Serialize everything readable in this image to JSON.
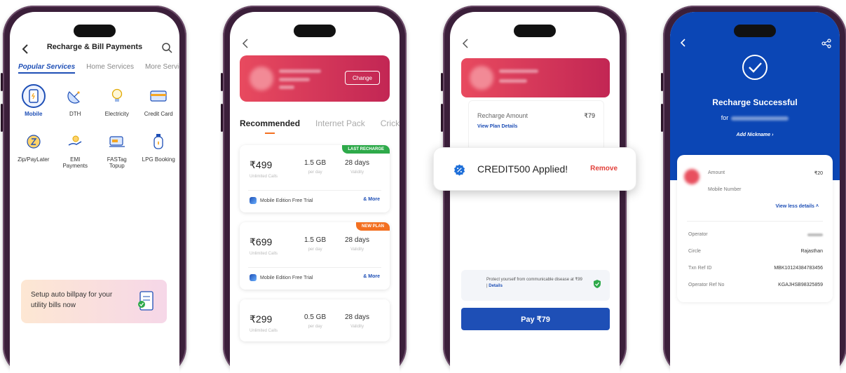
{
  "screen1": {
    "title": "Recharge & Bill Payments",
    "tabs": [
      "Popular Services",
      "Home Services",
      "More Services"
    ],
    "services": [
      {
        "label": "Mobile",
        "icon": "mobile-icon",
        "selected": true
      },
      {
        "label": "DTH",
        "icon": "satellite-dish-icon"
      },
      {
        "label": "Electricity",
        "icon": "bulb-icon"
      },
      {
        "label": "Credit Card",
        "icon": "credit-card-icon"
      },
      {
        "label": "Zip/PayLater",
        "icon": "zip-paylater-icon"
      },
      {
        "label": "EMI Payments",
        "icon": "emi-icon"
      },
      {
        "label": "FASTag Topup",
        "icon": "fastag-icon"
      },
      {
        "label": "LPG Booking",
        "icon": "gas-cylinder-icon"
      }
    ],
    "banner": "Setup auto billpay for your utility bills now"
  },
  "screen2": {
    "change_label": "Change",
    "tabs": [
      "Recommended",
      "Internet Pack",
      "Cricket"
    ],
    "plans": [
      {
        "price": "₹499",
        "data": "1.5 GB",
        "data_sub": "per day",
        "validity": "28 days",
        "validity_sub": "Validity",
        "calls_sub": "Unlimited Calls",
        "tag": "LAST RECHARGE",
        "perk": "Mobile Edition Free Trial",
        "more": "& More"
      },
      {
        "price": "₹699",
        "data": "1.5 GB",
        "data_sub": "per day",
        "validity": "28 days",
        "validity_sub": "Validity",
        "calls_sub": "Unlimited Calls",
        "tag": "NEW PLAN",
        "perk": "Mobile Edition Free Trial",
        "more": "& More"
      },
      {
        "price": "₹299",
        "data": "0.5 GB",
        "data_sub": "per day",
        "validity": "28 days",
        "validity_sub": "Validity",
        "calls_sub": "Unlimited Calls"
      }
    ],
    "colors": {
      "last_recharge": "#2eaa4a",
      "new_plan": "#f37021"
    }
  },
  "screen3": {
    "recharge_amount_label": "Recharge Amount",
    "recharge_amount_value": "₹79",
    "view_plan_details": "View Plan Details",
    "toast_message": "CREDIT500 Applied!",
    "toast_remove": "Remove",
    "protect_text": "Protect yourself from communicable disease at ₹99 |",
    "protect_link": "Details",
    "pay_button": "Pay ₹79"
  },
  "screen4": {
    "status": "Recharge Successful",
    "for_label": "for",
    "add_nickname": "Add Nickname",
    "amount_label": "Amount",
    "amount_value": "₹20",
    "mobile_number_label": "Mobile Number",
    "view_less": "View less details",
    "details": [
      {
        "label": "Operator",
        "value": ""
      },
      {
        "label": "Circle",
        "value": "Rajasthan"
      },
      {
        "label": "Txn Ref ID",
        "value": "MBK10124384783456"
      },
      {
        "label": "Operator Ref No",
        "value": "KGAJHSB98325859"
      }
    ]
  }
}
